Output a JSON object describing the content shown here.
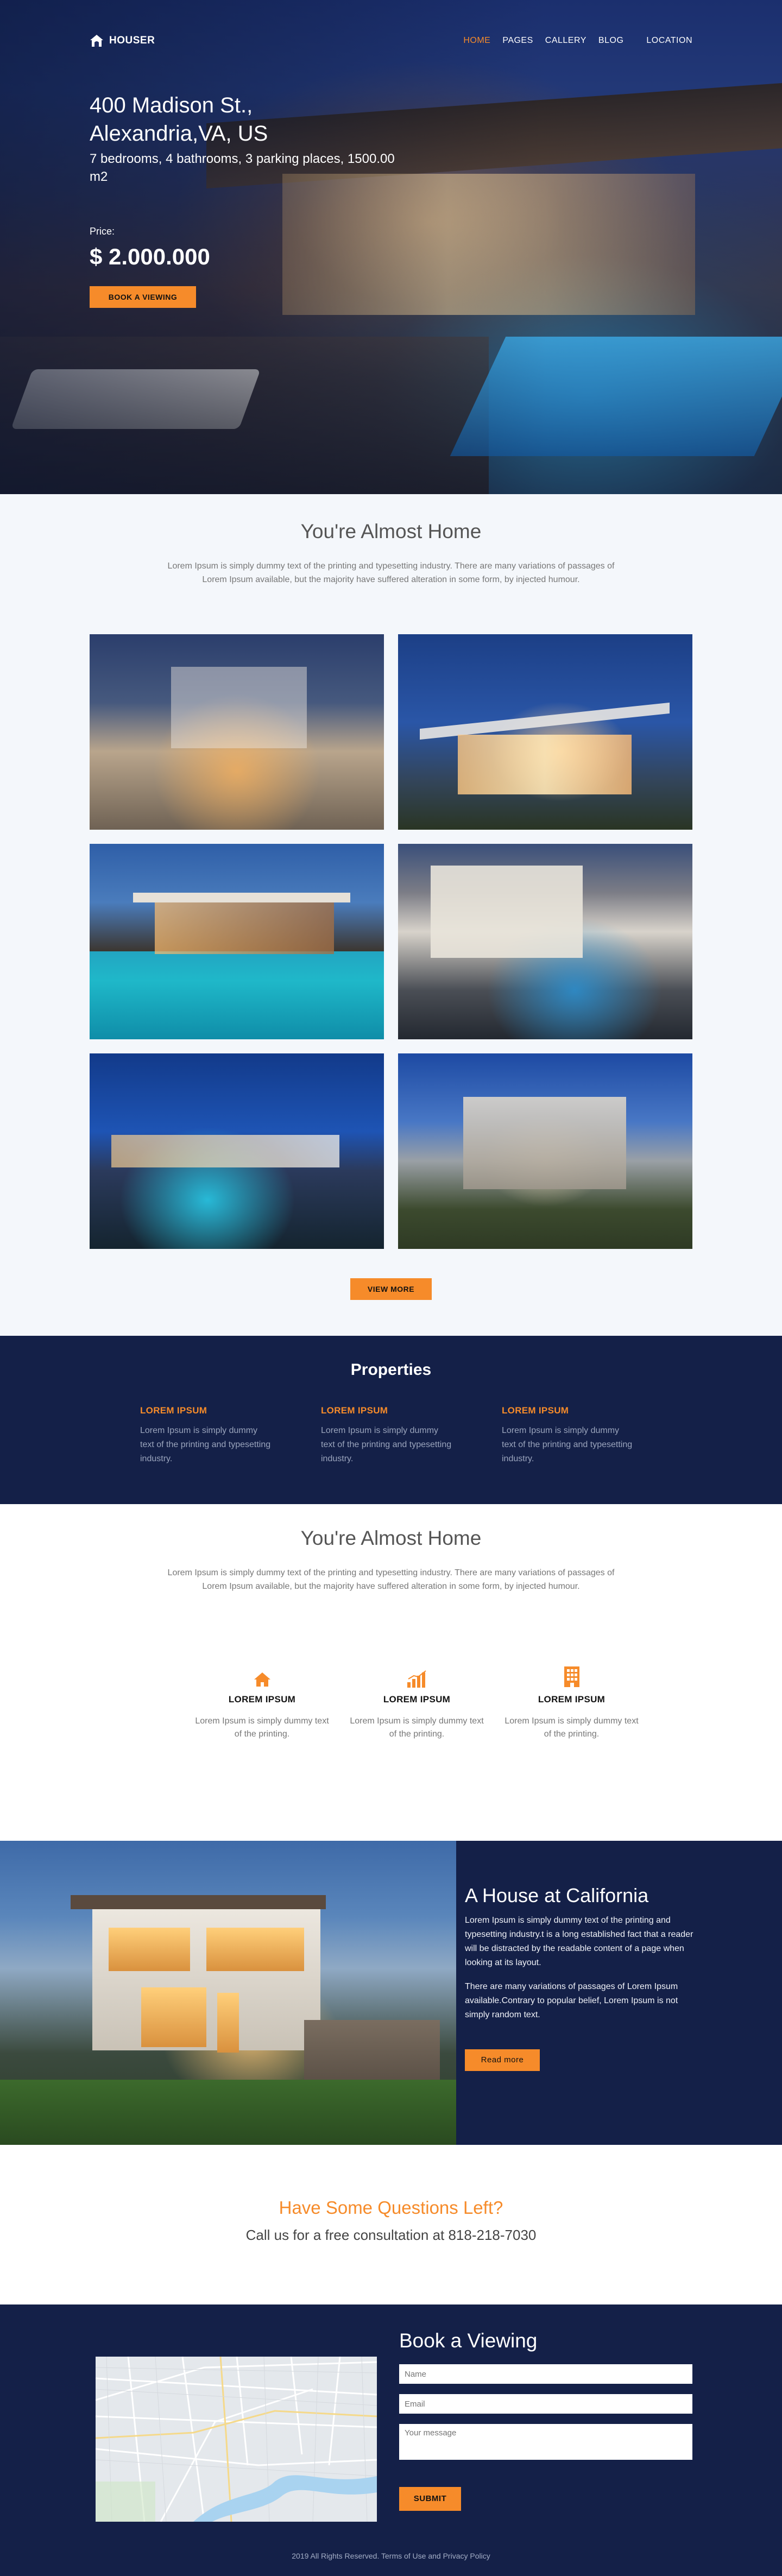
{
  "brand": {
    "name": "HOUSER"
  },
  "nav": {
    "items": [
      {
        "label": "HOME",
        "active": true
      },
      {
        "label": "PAGES",
        "active": false
      },
      {
        "label": "CALLERY",
        "active": false
      },
      {
        "label": "BLOG",
        "active": false
      },
      {
        "label": "LOCATION",
        "active": false
      }
    ]
  },
  "hero": {
    "title_line1": "400 Madison St.,",
    "title_line2": "Alexandria,VA, US",
    "details": "7 bedrooms, 4 bathrooms, 3 parking places, 1500.00 m2",
    "price_label": "Price:",
    "price": "$ 2.000.000",
    "button": "BOOK A VIEWING"
  },
  "gallery": {
    "title": "You're Almost Home",
    "description": "Lorem Ipsum is simply dummy text of the printing and typesetting industry. There are many variations of passages of Lorem Ipsum available, but the majority have suffered alteration in some form, by injected humour.",
    "button": "VIEW MORE"
  },
  "properties": {
    "title": "Properties",
    "items": [
      {
        "heading": "LOREM IPSUM",
        "text": "Lorem Ipsum is simply dummy text of the printing and typesetting industry."
      },
      {
        "heading": "LOREM IPSUM",
        "text": "Lorem Ipsum is simply dummy text of the printing and typesetting industry."
      },
      {
        "heading": "LOREM IPSUM",
        "text": "Lorem Ipsum is simply dummy text of the printing and typesetting industry."
      }
    ]
  },
  "features": {
    "title": "You're Almost Home",
    "description": "Lorem Ipsum is simply dummy text of the printing and typesetting industry. There are many variations of passages of Lorem Ipsum available, but the majority have suffered alteration in some form, by injected humour.",
    "items": [
      {
        "icon": "home-icon",
        "heading": "LOREM IPSUM",
        "text": "Lorem Ipsum is simply dummy text of the printing."
      },
      {
        "icon": "bar-chart-icon",
        "heading": "LOREM IPSUM",
        "text": "Lorem Ipsum is simply dummy text of the printing."
      },
      {
        "icon": "building-icon",
        "heading": "LOREM IPSUM",
        "text": "Lorem Ipsum is simply dummy text of the printing."
      }
    ]
  },
  "california": {
    "title": "A House at California",
    "para1": "Lorem Ipsum is simply dummy text of the printing and typesetting industry.t is a long established fact that a reader will be distracted by the readable content of a page when looking at its layout.",
    "para2": "There are many variations of passages of Lorem Ipsum available.Contrary to popular belief, Lorem Ipsum is not simply random text.",
    "button": "Read more"
  },
  "cta": {
    "title": "Have Some Questions Left?",
    "subtitle": "Call us for a free consultation at 818-218-7030"
  },
  "booking": {
    "title": "Book a Viewing",
    "name_placeholder": "Name",
    "email_placeholder": "Email",
    "message_placeholder": "Your message",
    "submit": "SUBMIT"
  },
  "footer": {
    "text": "2019 All Rights Reserved. Terms of Use and Privacy Policy"
  },
  "colors": {
    "accent": "#f68b2a",
    "navy": "#142048",
    "light_bg": "#f4f7fb"
  }
}
